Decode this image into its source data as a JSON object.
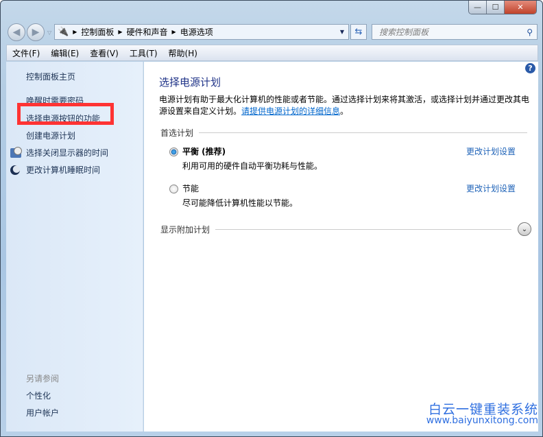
{
  "window": {
    "min": "—",
    "max": "☐",
    "close": "✕"
  },
  "address": {
    "segments": [
      "控制面板",
      "硬件和声音",
      "电源选项"
    ]
  },
  "search": {
    "placeholder": "搜索控制面板"
  },
  "menu": [
    "文件(F)",
    "编辑(E)",
    "查看(V)",
    "工具(T)",
    "帮助(H)"
  ],
  "sidebar": {
    "home": "控制面板主页",
    "items": [
      "唤醒时需要密码",
      "选择电源按钮的功能",
      "创建电源计划",
      "选择关闭显示器的时间",
      "更改计算机睡眠时间"
    ],
    "see_also": "另请参阅",
    "see_also_items": [
      "个性化",
      "用户帐户"
    ]
  },
  "main": {
    "title": "选择电源计划",
    "description": "电源计划有助于最大化计算机的性能或者节能。通过选择计划来将其激活，或选择计划并通过更改其电源设置来自定义计划。",
    "info_link": "请提供电源计划的详细信息",
    "period": "。",
    "preferred": "首选计划",
    "plans": [
      {
        "name": "平衡 (推荐)",
        "desc": "利用可用的硬件自动平衡功耗与性能。",
        "link": "更改计划设置",
        "selected": true
      },
      {
        "name": "节能",
        "desc": "尽可能降低计算机性能以节能。",
        "link": "更改计划设置",
        "selected": false
      }
    ],
    "additional": "显示附加计划",
    "help": "?"
  },
  "watermark": {
    "name": "白云一键重装系统",
    "url": "www.baiyunxitong.com"
  }
}
